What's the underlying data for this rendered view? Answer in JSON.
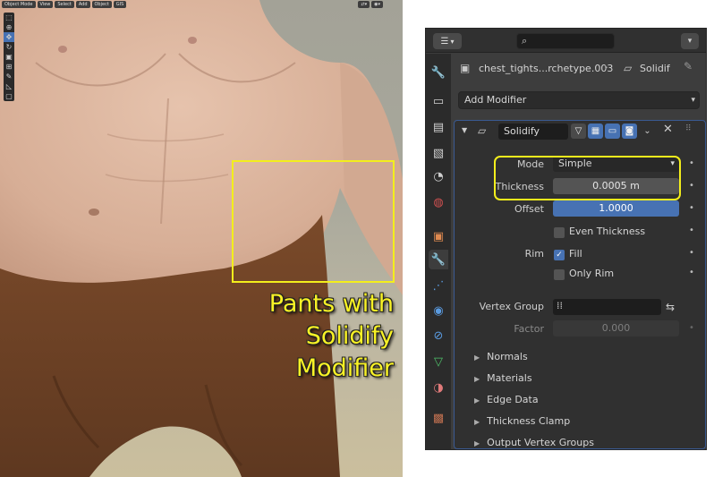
{
  "viewport": {
    "header_buttons": [
      "Object Mode",
      "View",
      "Select",
      "Add",
      "Object",
      "GIS"
    ],
    "toolbar_icons": [
      "select-box-icon",
      "cursor-icon",
      "move-icon",
      "rotate-icon",
      "scale-icon",
      "transform-icon",
      "annotate-icon",
      "measure-icon",
      "add-cube-icon"
    ],
    "active_tool": "move-icon",
    "caption_lines": [
      "Pants with",
      "Solidify",
      "Modifier"
    ],
    "highlight_color": "#f3ee1c"
  },
  "properties": {
    "object_name": "chest_tights...rchetype.003",
    "modifier_name_header": "Solidif",
    "add_modifier_label": "Add Modifier",
    "modifier": {
      "name": "Solidify",
      "mode_label": "Mode",
      "mode_value": "Simple",
      "thickness_label": "Thickness",
      "thickness_value": "0.0005 m",
      "offset_label": "Offset",
      "offset_value": "1.0000",
      "offset_fill": 1.0,
      "even_thickness_label": "Even Thickness",
      "even_thickness_checked": false,
      "rim_label": "Rim",
      "fill_label": "Fill",
      "fill_checked": true,
      "only_rim_label": "Only Rim",
      "only_rim_checked": false,
      "vertex_group_label": "Vertex Group",
      "vertex_group_value": "",
      "factor_label": "Factor",
      "factor_value": "0.000",
      "subpanels": [
        "Normals",
        "Materials",
        "Edge Data",
        "Thickness Clamp",
        "Output Vertex Groups"
      ]
    },
    "tabs": [
      "tool-icon",
      "render-icon",
      "output-icon",
      "view-layer-icon",
      "scene-icon",
      "world-icon",
      "object-icon",
      "modifier-icon",
      "particles-icon",
      "physics-icon",
      "constraints-icon",
      "data-icon",
      "material-icon",
      "texture-icon"
    ],
    "active_tab": "modifier-icon",
    "accent_color": "#4772b3"
  }
}
